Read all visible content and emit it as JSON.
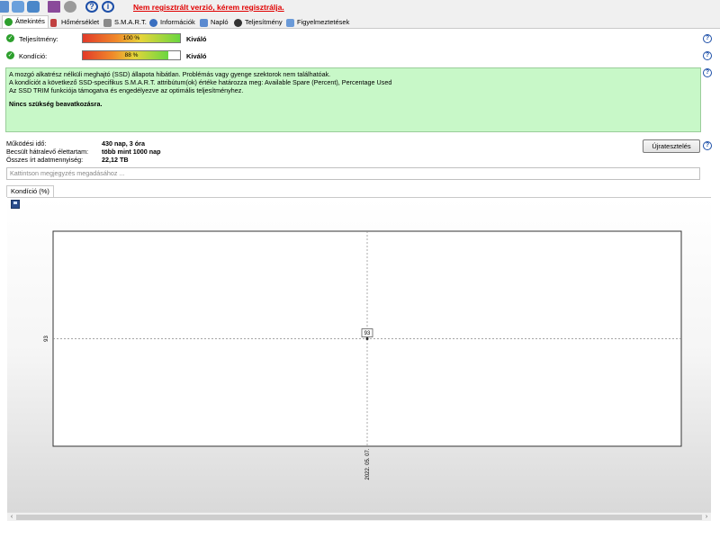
{
  "toolbar": {
    "reg_link": "Nem regisztrált verzió, kérem regisztrálja."
  },
  "tabs": [
    {
      "label": "Áttekintés",
      "active": true
    },
    {
      "label": "Hőmérséklet"
    },
    {
      "label": "S.M.A.R.T."
    },
    {
      "label": "Információk"
    },
    {
      "label": "Napló"
    },
    {
      "label": "Teljesítmény"
    },
    {
      "label": "Figyelmeztetések"
    }
  ],
  "status": {
    "performance": {
      "label": "Teljesítmény:",
      "value": "100 %",
      "percent": 100,
      "rating": "Kiváló"
    },
    "condition": {
      "label": "Kondíció:",
      "value": "88 %",
      "percent": 88,
      "rating": "Kiváló"
    }
  },
  "message": {
    "line1": "A mozgó alkatrész nélküli meghajtó (SSD) állapota hibátlan. Problémás vagy gyenge szektorok nem találhatóak.",
    "line2": "A kondíciót a következő SSD-specifikus S.M.A.R.T. attribútum(ok) értéke határozza meg:  Available Spare (Percent), Percentage Used",
    "line3": "Az SSD TRIM funkciója támogatva és engedélyezve az optimális teljesítményhez.",
    "bold": "Nincs szükség beavatkozásra."
  },
  "info": {
    "uptime_label": "Működési idő:",
    "uptime_value": "430 nap, 3 óra",
    "remaining_label": "Becsült hátralevő élettartam:",
    "remaining_value": "több mint 1000 nap",
    "written_label": "Összes írt adatmennyiség:",
    "written_value": "22,12 TB"
  },
  "reset_button": "Újratesztelés",
  "note_placeholder": "Kattintson megjegyzés megadásához ...",
  "chart_tab": "Kondíció  (%)",
  "chart_data": {
    "type": "line",
    "x": [
      "2022. 05. 07."
    ],
    "values": [
      93
    ],
    "point_label": "93",
    "y_tick": "93",
    "x_tick": "2022. 05. 07."
  },
  "colors": {
    "accent": "#e00000",
    "ok": "#2d9f2d",
    "message_bg": "#c8f8c8"
  }
}
